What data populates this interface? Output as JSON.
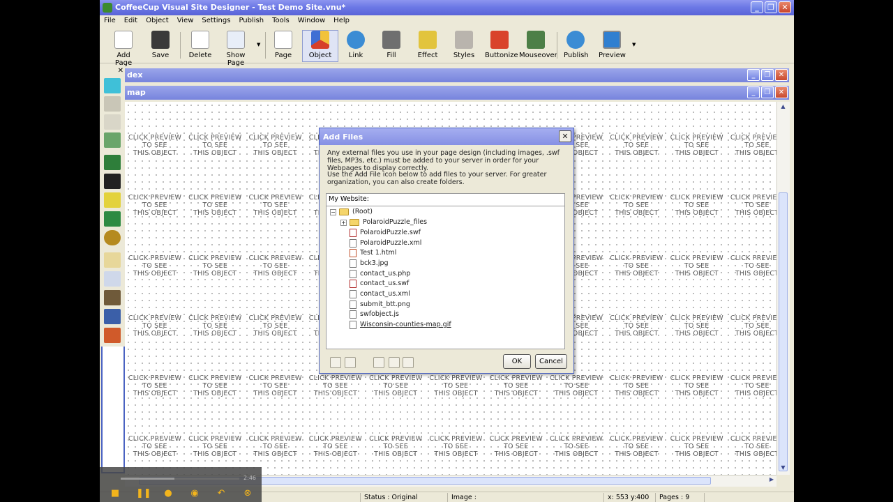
{
  "window": {
    "title": "CoffeeCup Visual Site Designer - Test Demo Site.vnu*"
  },
  "menu": [
    "File",
    "Edit",
    "Object",
    "View",
    "Settings",
    "Publish",
    "Tools",
    "Window",
    "Help"
  ],
  "toolbar": {
    "add_page": "Add Page",
    "save": "Save",
    "delete": "Delete",
    "show_page": "Show Page",
    "page": "Page",
    "object": "Object",
    "link": "Link",
    "fill": "Fill",
    "effect": "Effect",
    "styles": "Styles",
    "buttonize": "Buttonize",
    "mouseover": "Mouseover",
    "publish": "Publish",
    "preview": "Preview"
  },
  "documents": {
    "index_title": "dex",
    "map_title": "map"
  },
  "canvas": {
    "placeholder_line1": "CLICK PREVIEW",
    "placeholder_line2": "TO SEE",
    "placeholder_line3": "THIS OBJECT"
  },
  "dialog": {
    "title": "Add Files",
    "paragraph1": "Any external files you use in your page design (including images, .swf files, MP3s, etc.) must be added to your server in order for your Webpages to display correctly.",
    "paragraph2": "Use the Add File icon below to add files to your server. For greater organization, you can also create folders.",
    "site_label": "My Website:",
    "root": "(Root)",
    "files": [
      "PolaroidPuzzle_files",
      "PolaroidPuzzle.swf",
      "PolaroidPuzzle.xml",
      "Test 1.html",
      "bck3.jpg",
      "contact_us.php",
      "contact_us.swf",
      "contact_us.xml",
      "submit_btt.png",
      "swfobject.js",
      "Wisconsin-counties-map.gif"
    ],
    "ok": "OK",
    "cancel": "Cancel"
  },
  "status": {
    "status_text": "Status : Original",
    "image_text": "Image :",
    "coords_text": "x: 553  y:400",
    "pages_text": "Pages : 9"
  },
  "video": {
    "time": "2:46",
    "progress": 0.45
  },
  "colors": {
    "titlebar": "#6d79e6",
    "accent": "#4b63c2",
    "canvas_bg": "#ffffff"
  }
}
